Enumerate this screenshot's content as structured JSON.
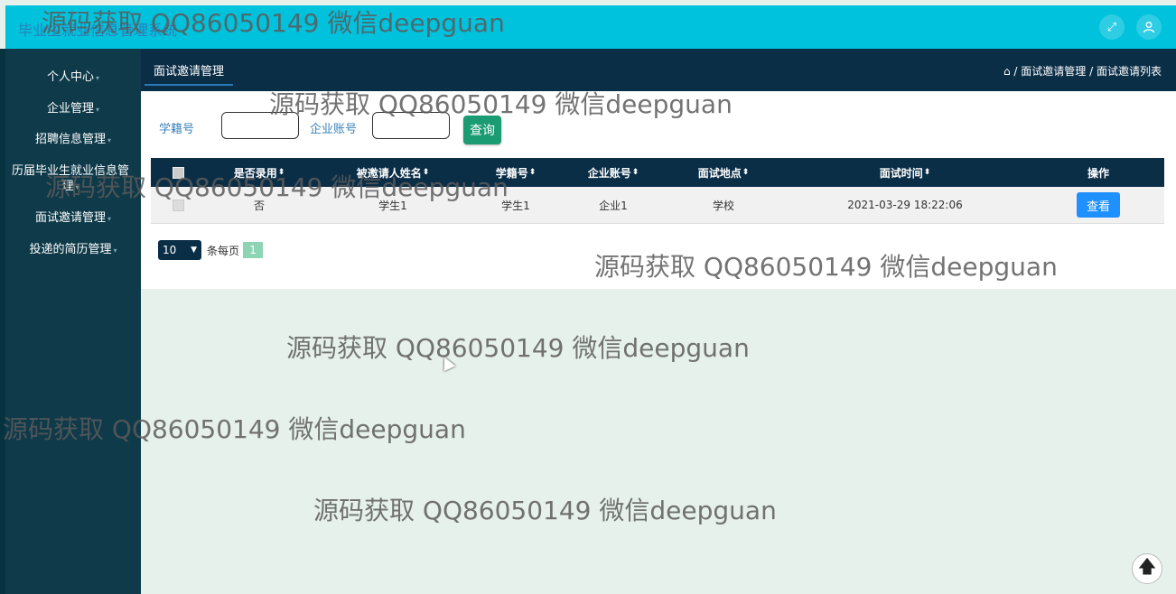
{
  "header": {
    "title": "毕业生就业信息管理系统",
    "fullscreen_icon": "expand-icon",
    "user_icon": "user-icon"
  },
  "sidebar": {
    "items": [
      {
        "label": "个人中心"
      },
      {
        "label": "企业管理"
      },
      {
        "label": "招聘信息管理"
      },
      {
        "label": "历届毕业生就业信息管理"
      },
      {
        "label": "面试邀请管理"
      },
      {
        "label": "投递的简历管理"
      }
    ]
  },
  "main": {
    "tab_label": "面试邀请管理",
    "breadcrumb": {
      "home_icon": "home-icon",
      "level1": "面试邀请管理",
      "level2": "面试邀请列表",
      "sep": "/"
    }
  },
  "search": {
    "label1": "学籍号",
    "label2": "企业账号",
    "input1_value": "",
    "input2_value": "",
    "button_label": "查询"
  },
  "table": {
    "columns": [
      "是否录用",
      "被邀请人姓名",
      "学籍号",
      "企业账号",
      "面试地点",
      "面试时间",
      "操作"
    ],
    "rows": [
      {
        "hired": "否",
        "name": "学生1",
        "student_id": "学生1",
        "company": "企业1",
        "location": "学校",
        "time": "2021-03-29 18:22:06",
        "action": "查看"
      }
    ]
  },
  "pagination": {
    "page_size": "10",
    "page_size_suffix": "条每页",
    "current_page": "1"
  },
  "watermark": "源码获取 QQ86050149 微信deepguan",
  "colors": {
    "header": "#00c2dd",
    "sidebar": "#0e3a49",
    "main_header": "#0b2e47",
    "primary": "#1e90ff",
    "search_button": "#1a9b72",
    "background": "#e6f1ec"
  }
}
